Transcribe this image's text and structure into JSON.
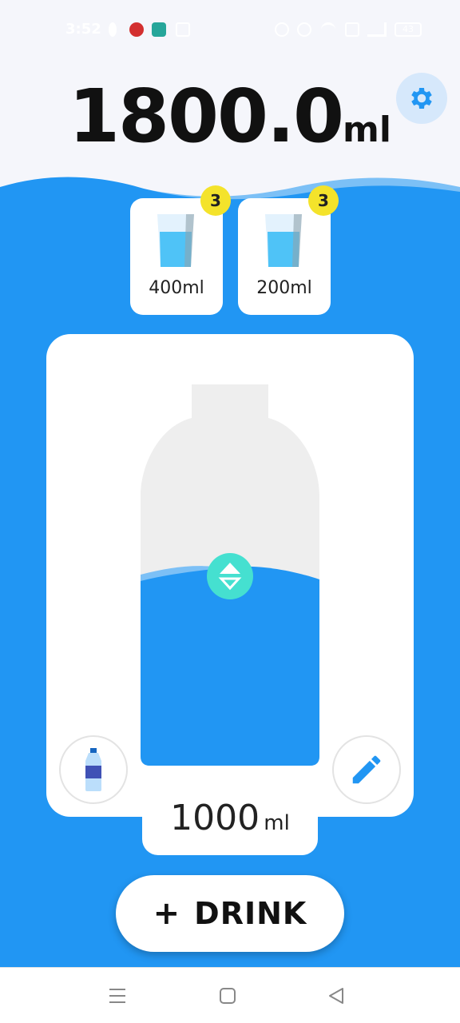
{
  "status_bar": {
    "time": "3:52",
    "battery": "43"
  },
  "summary": {
    "total_value": "1800.0",
    "total_unit": "ml"
  },
  "settings": {
    "icon": "gear-icon"
  },
  "cups": [
    {
      "label": "400ml",
      "count": "3"
    },
    {
      "label": "200ml",
      "count": "3"
    }
  ],
  "bottle": {
    "fill_fraction": 0.5,
    "volume_value": "1000",
    "volume_unit": "ml"
  },
  "actions": {
    "bottle_icon": "water-bottle-icon",
    "edit_icon": "pencil-icon",
    "drink_plus": "+",
    "drink_label": "DRINK"
  },
  "colors": {
    "water": "#2196F3",
    "water_light": "#7CC0F6",
    "badge": "#F4E32B",
    "handle": "#45E0D0",
    "bottle_empty": "#EEEEEE"
  }
}
